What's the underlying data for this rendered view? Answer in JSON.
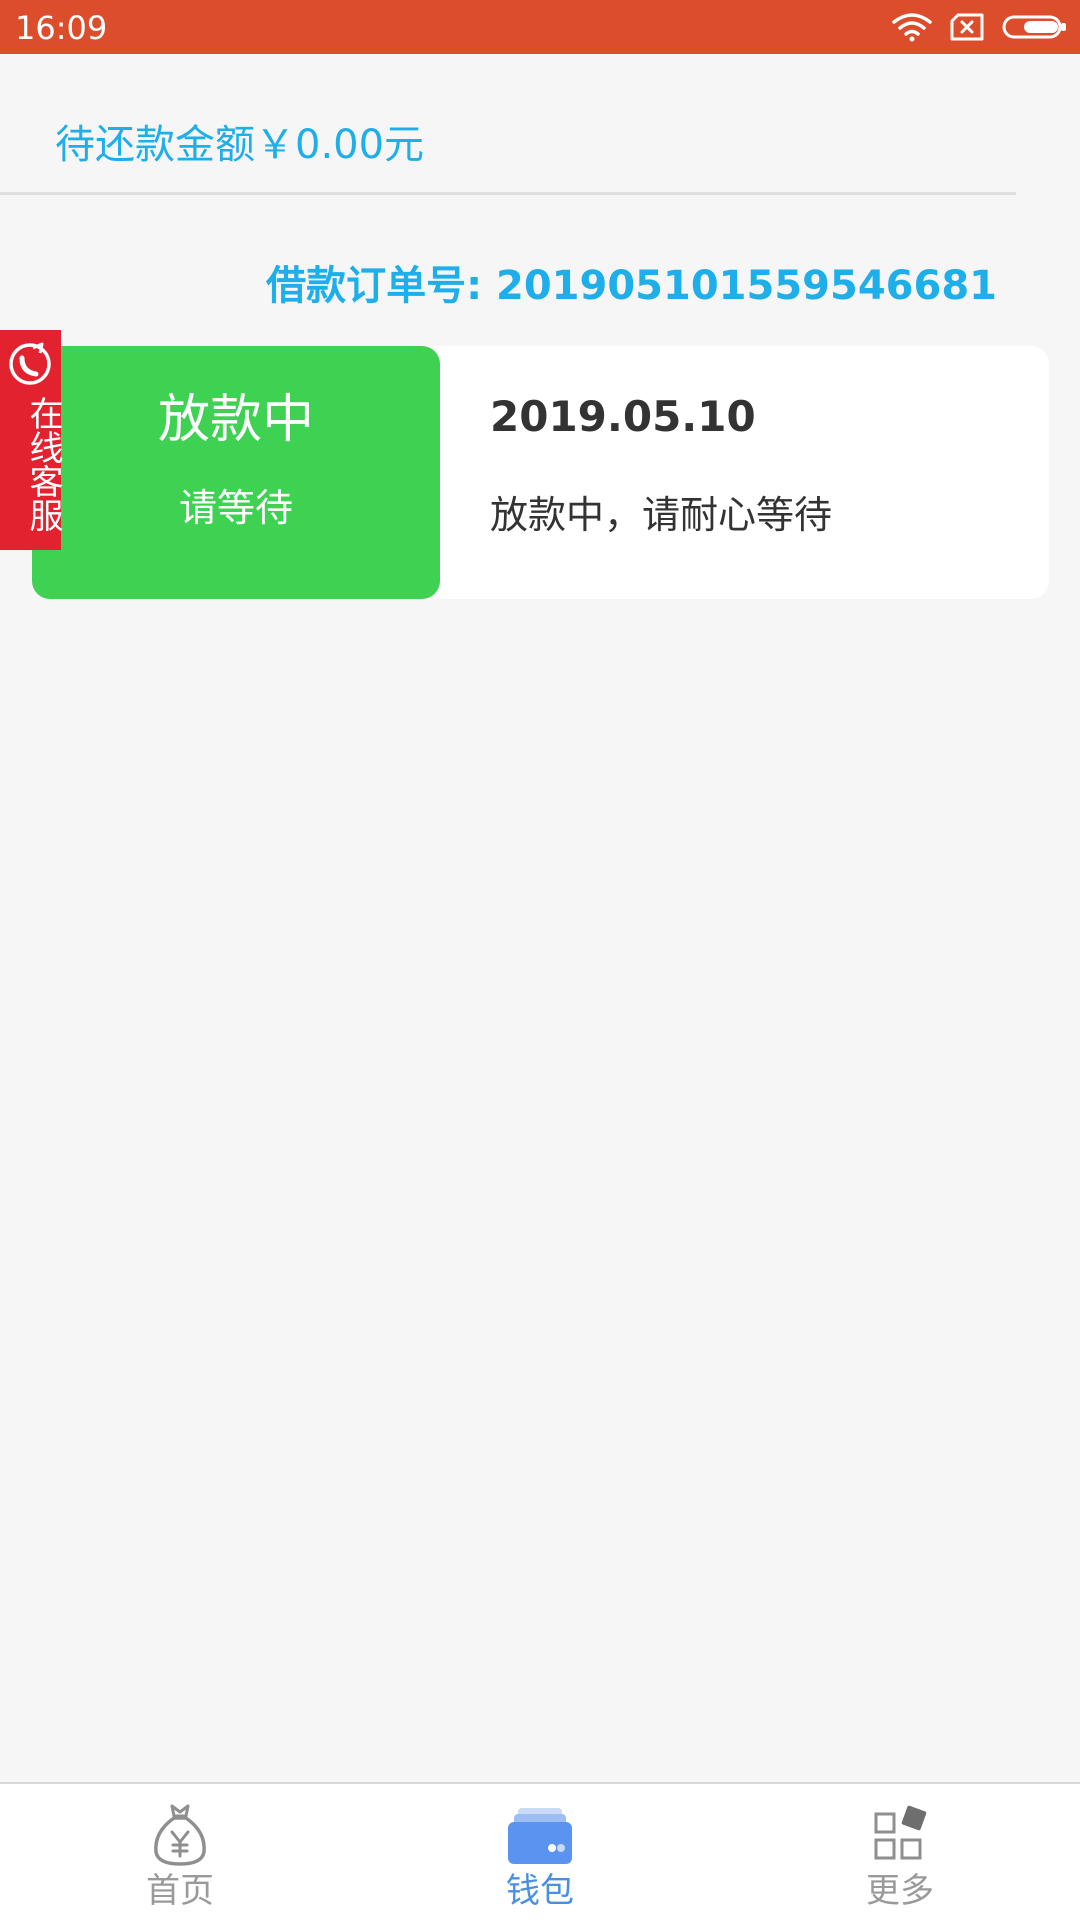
{
  "status_bar": {
    "time": "16:09"
  },
  "repay": {
    "amount_text": "待还款金额￥0.00元"
  },
  "order": {
    "label": "借款订单号:",
    "number": "201905101559546681"
  },
  "loan_card": {
    "status_title": "放款中",
    "status_subtitle": "请等待",
    "date": "2019.05.10",
    "message": "放款中，请耐心等待"
  },
  "service_tab": {
    "label": "在线客服"
  },
  "bottom_nav": {
    "items": [
      {
        "label": "首页",
        "icon": "money-bag-icon",
        "active": false
      },
      {
        "label": "钱包",
        "icon": "wallet-icon",
        "active": true
      },
      {
        "label": "更多",
        "icon": "grid-icon",
        "active": false
      }
    ]
  },
  "colors": {
    "status_bar": "#dc4d2c",
    "accent_blue": "#1eaee9",
    "status_green": "#3fd152",
    "service_red": "#e32230",
    "nav_inactive": "#9a9a9a",
    "nav_active": "#4a90e2"
  }
}
